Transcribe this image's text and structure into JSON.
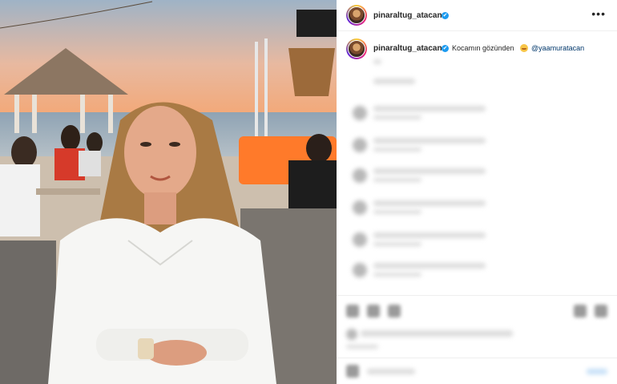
{
  "post": {
    "username": "pinaraltug_atacan",
    "verified_mark": "✔",
    "more_label": "•••"
  },
  "caption": {
    "username": "pinaraltug_atacan",
    "text": "Kocamın gözünden",
    "mention": "@yaamuratacan",
    "emoji": "smiling-face-with-heart-eyes-icon"
  },
  "colors": {
    "verified": "#1d9bf0",
    "mention": "#00376b",
    "text": "#262626"
  }
}
